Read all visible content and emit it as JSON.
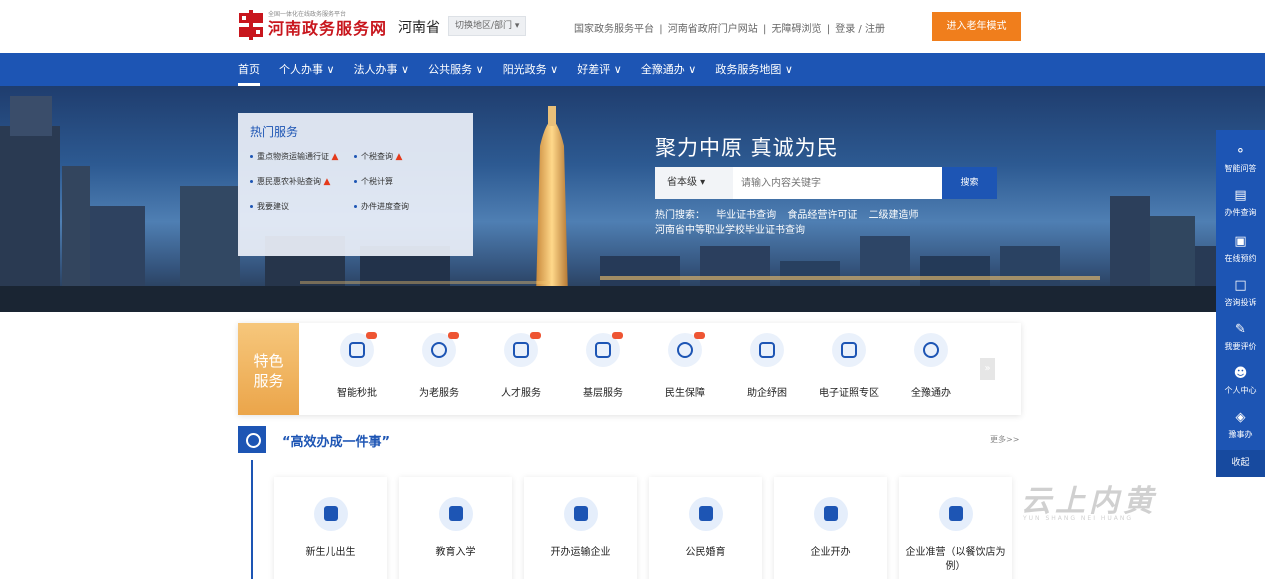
{
  "header": {
    "logo_sub": "全国一体化在线政务服务平台",
    "logo_title": "河南政务服务网",
    "region": "河南省",
    "region_switch": "切换地区/部门 ▾",
    "links": [
      "国家政务服务平台",
      "河南省政府门户网站",
      "无障碍浏览",
      "登录 / 注册"
    ],
    "elder_button": "进入老年模式"
  },
  "nav": {
    "items": [
      "首页",
      "个人办事 ∨",
      "法人办事 ∨",
      "公共服务 ∨",
      "阳光政务 ∨",
      "好差评 ∨",
      "全豫通办 ∨",
      "政务服务地图 ∨"
    ]
  },
  "hot_services": {
    "title": "热门服务",
    "items": [
      "重点物资运输通行证",
      "个税查询",
      "惠民惠农补贴查询",
      "个税计算",
      "我要建议",
      "办件进度查询"
    ]
  },
  "search": {
    "slogan": "聚力中原  真诚为民",
    "level": "省本级   ▾",
    "placeholder": "请输入内容关键字",
    "button": "搜索",
    "hot_label": "热门搜索：",
    "hot_terms": [
      "毕业证书查询",
      "食品经营许可证",
      "二级建造师",
      "河南省中等职业学校毕业证书查询"
    ]
  },
  "features": {
    "label": "特色服务",
    "items": [
      "智能秒批",
      "为老服务",
      "人才服务",
      "基层服务",
      "民生保障",
      "助企纾困",
      "电子证照专区",
      "全豫通办"
    ],
    "next": "»"
  },
  "section": {
    "title": "“高效办成一件事”",
    "more": "更多>>",
    "cards": [
      "新生儿出生",
      "教育入学",
      "开办运输企业",
      "公民婚育",
      "企业开办",
      "企业准营（以餐饮店为例）"
    ]
  },
  "sidebar": {
    "items": [
      {
        "icon": "chat-icon",
        "label": "智能问答"
      },
      {
        "icon": "search-doc-icon",
        "label": "办件查询"
      },
      {
        "icon": "calendar-icon",
        "label": "在线预约"
      },
      {
        "icon": "message-icon",
        "label": "咨询投诉"
      },
      {
        "icon": "edit-icon",
        "label": "我要评价"
      },
      {
        "icon": "user-icon",
        "label": "个人中心"
      },
      {
        "icon": "app-icon",
        "label": "豫事办"
      }
    ],
    "collapse": "收起"
  },
  "watermark": {
    "main": "云上内黄",
    "sub": "YUN SHANG NEI HUANG"
  },
  "colors": {
    "primary": "#1d55b4",
    "accent": "#f07e1c",
    "brand_red": "#c8161d"
  }
}
